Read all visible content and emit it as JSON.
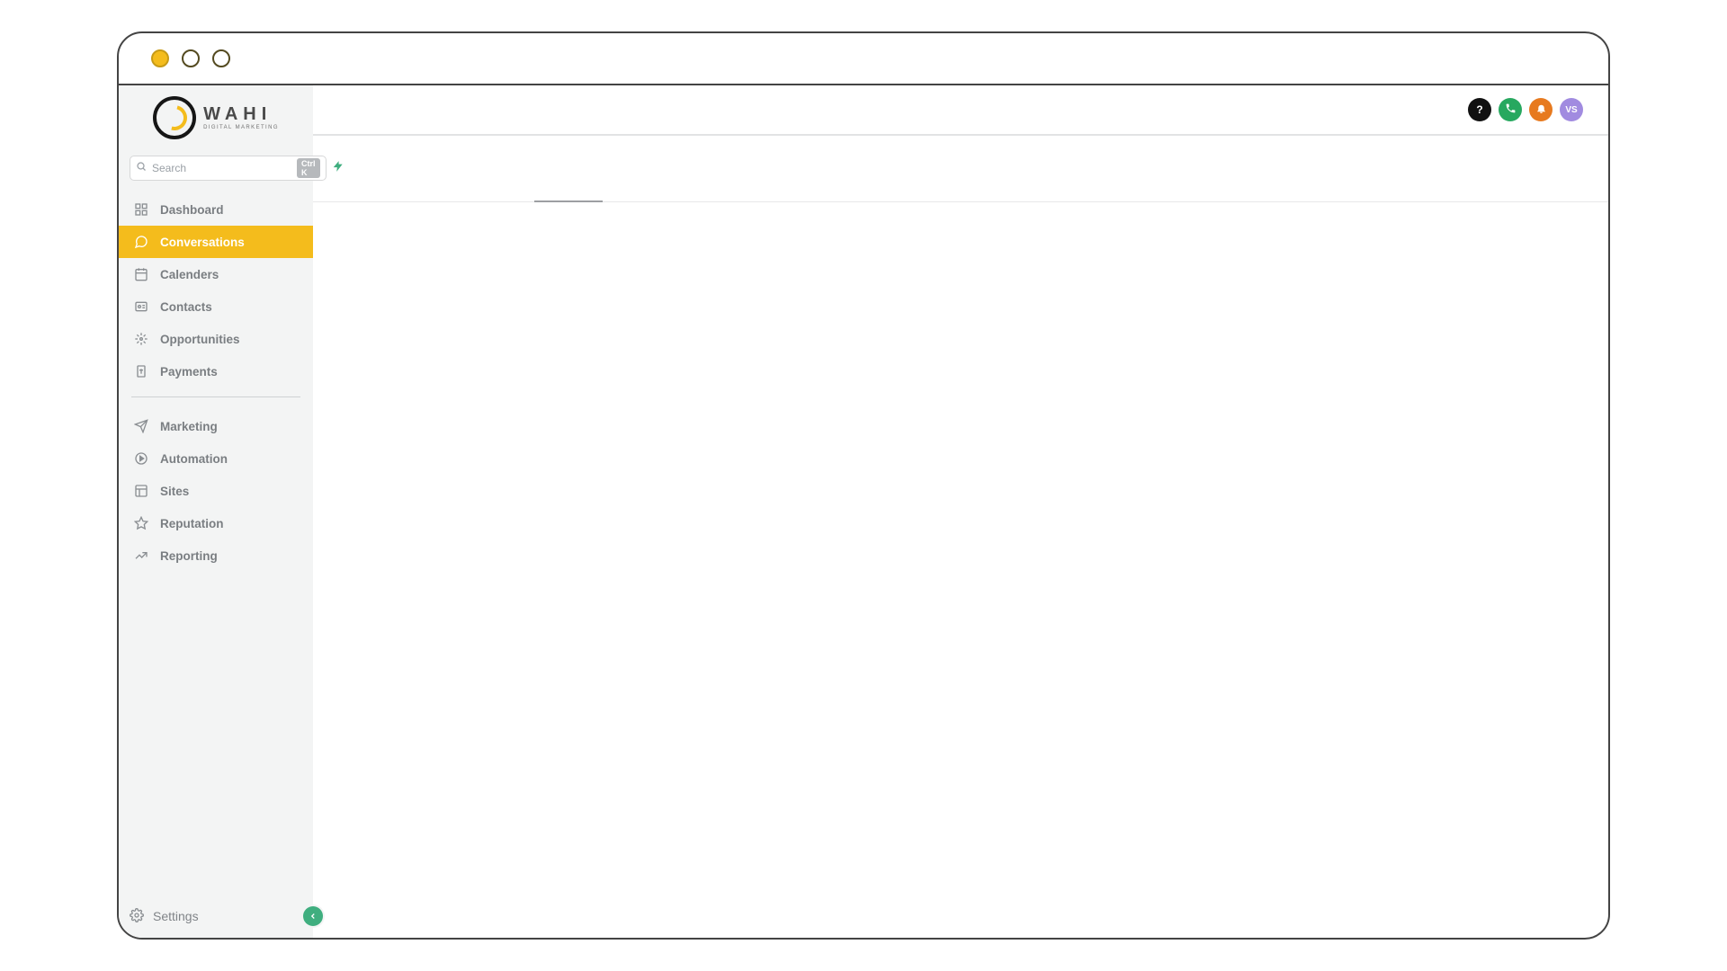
{
  "brand": {
    "name": "WAHI",
    "tagline": "DIGITAL MARKETING"
  },
  "search": {
    "placeholder": "Search",
    "shortcut": "Ctrl K"
  },
  "nav": {
    "primary": [
      {
        "key": "dashboard",
        "label": "Dashboard",
        "icon": "grid"
      },
      {
        "key": "conversations",
        "label": "Conversations",
        "icon": "chat",
        "active": true
      },
      {
        "key": "calenders",
        "label": "Calenders",
        "icon": "calendar"
      },
      {
        "key": "contacts",
        "label": "Contacts",
        "icon": "card"
      },
      {
        "key": "opportunities",
        "label": "Opportunities",
        "icon": "spark"
      },
      {
        "key": "payments",
        "label": "Payments",
        "icon": "receipt"
      }
    ],
    "secondary": [
      {
        "key": "marketing",
        "label": "Marketing",
        "icon": "send"
      },
      {
        "key": "automation",
        "label": "Automation",
        "icon": "play"
      },
      {
        "key": "sites",
        "label": "Sites",
        "icon": "layout"
      },
      {
        "key": "reputation",
        "label": "Reputation",
        "icon": "star"
      },
      {
        "key": "reporting",
        "label": "Reporting",
        "icon": "trend"
      }
    ]
  },
  "footer": {
    "settings": "Settings"
  },
  "header": {
    "avatar": "VS"
  }
}
